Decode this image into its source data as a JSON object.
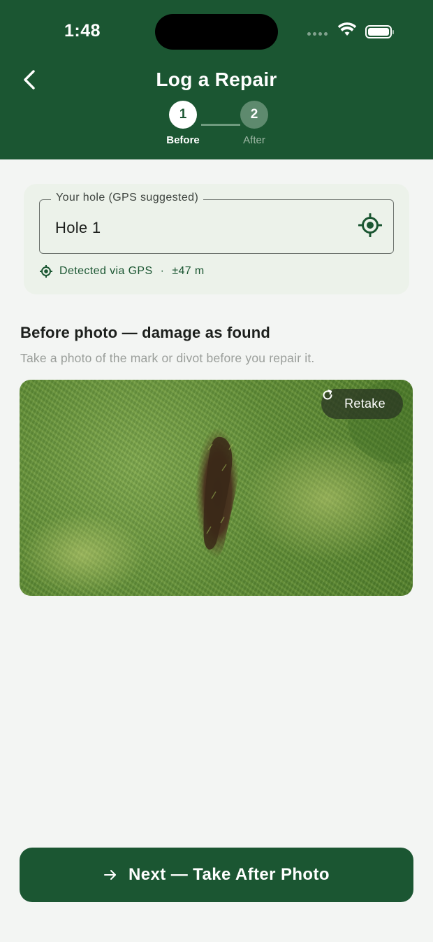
{
  "status_bar": {
    "time": "1:48"
  },
  "header": {
    "title": "Log a Repair",
    "back_icon": "chevron-left-icon",
    "steps": [
      {
        "number": "1",
        "label": "Before",
        "state": "active"
      },
      {
        "number": "2",
        "label": "After",
        "state": "pending"
      }
    ]
  },
  "hole_field": {
    "label": "Your hole (GPS suggested)",
    "value": "Hole 1",
    "locate_icon": "crosshair-icon",
    "gps_status": "Detected via GPS",
    "separator": "·",
    "accuracy": "±47 m"
  },
  "before_section": {
    "title": "Before photo — damage as found",
    "subtitle": "Take a photo of the mark or divot before you repair it.",
    "retake_label": "Retake"
  },
  "footer": {
    "next_label": "Next — Take After Photo"
  },
  "colors": {
    "primary": "#1b5632",
    "card_bg": "#ecf2ea",
    "page_bg": "#f3f5f3"
  }
}
